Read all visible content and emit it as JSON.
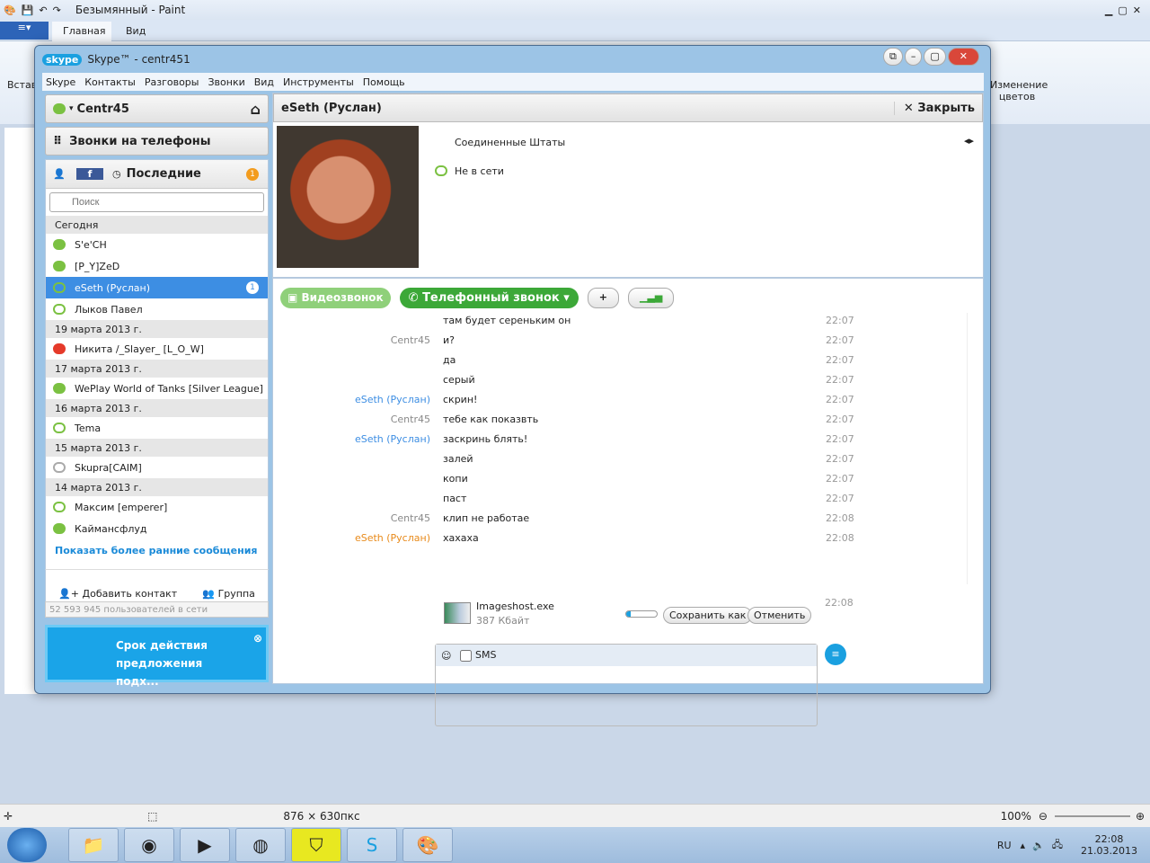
{
  "paint": {
    "title": "Безымянный - Paint",
    "tabs": [
      "Главная",
      "Вид"
    ],
    "paste": "Вставить",
    "colors": "Изменение цветов",
    "status_size": "876 × 630пкс",
    "zoom": "100%"
  },
  "skype": {
    "title": "Skype™ - centr451",
    "logo": "skype",
    "menu": [
      "Skype",
      "Контакты",
      "Разговоры",
      "Звонки",
      "Вид",
      "Инструменты",
      "Помощь"
    ],
    "user": "Centr45",
    "calls_phones": "Звонки на телефоны",
    "recent": "Последние",
    "recent_badge": "1",
    "search_placeholder": "Поиск",
    "contacts": [
      {
        "type": "date",
        "label": "Сегодня"
      },
      {
        "type": "c",
        "name": "S'e'CH",
        "status": "on"
      },
      {
        "type": "c",
        "name": "[P_Y]ZeD",
        "status": "on"
      },
      {
        "type": "c",
        "name": "eSeth (Руслан)",
        "status": "off",
        "selected": true,
        "badge": "1"
      },
      {
        "type": "c",
        "name": "Лыков Павел",
        "status": "off"
      },
      {
        "type": "date",
        "label": "19 марта 2013 г."
      },
      {
        "type": "c",
        "name": "Никита /_Slayer_ [L_O_W]",
        "status": "red"
      },
      {
        "type": "date",
        "label": "17 марта 2013 г."
      },
      {
        "type": "c",
        "name": "WePlay World of Tanks [Silver League]",
        "status": "on"
      },
      {
        "type": "date",
        "label": "16 марта 2013 г."
      },
      {
        "type": "c",
        "name": "Tema",
        "status": "off"
      },
      {
        "type": "date",
        "label": "15 марта 2013 г."
      },
      {
        "type": "c",
        "name": "Skupra[CAIM]",
        "status": "q"
      },
      {
        "type": "date",
        "label": "14 марта 2013 г."
      },
      {
        "type": "c",
        "name": "Максим [emperer]",
        "status": "off"
      },
      {
        "type": "c",
        "name": "Каймансфлуд",
        "status": "on"
      }
    ],
    "show_earlier": "Показать более ранние сообщения",
    "add_contact": "Добавить контакт",
    "group": "Группа",
    "online": "52 593 945 пользователей в сети",
    "promo": "Срок действия предложения подх...",
    "chat": {
      "name": "eSeth (Руслан)",
      "close": "Закрыть",
      "country": "Соединенные Штаты",
      "status": "Не в сети",
      "video": "Видеозвонок",
      "phone": "Телефонный звонок",
      "messages": [
        {
          "s": "",
          "t": "там будет сереньким он",
          "tm": "22:07"
        },
        {
          "s": "Centr45",
          "t": "и?",
          "tm": "22:07"
        },
        {
          "s": "",
          "t": "да",
          "tm": "22:07"
        },
        {
          "s": "",
          "t": "серый",
          "tm": "22:07"
        },
        {
          "s": "eSeth (Руслан)",
          "t": "скрин!",
          "tm": "22:07",
          "c": "#3d8ee3"
        },
        {
          "s": "Centr45",
          "t": "тебе как показвть",
          "tm": "22:07"
        },
        {
          "s": "eSeth (Руслан)",
          "t": "заскринь блять!",
          "tm": "22:07",
          "c": "#3d8ee3"
        },
        {
          "s": "",
          "t": "залей",
          "tm": "22:07"
        },
        {
          "s": "",
          "t": "копи",
          "tm": "22:07"
        },
        {
          "s": "",
          "t": "паст",
          "tm": "22:07"
        },
        {
          "s": "Centr45",
          "t": "клип не работае",
          "tm": "22:08"
        },
        {
          "s": "eSeth (Руслан)",
          "t": "хахаха",
          "tm": "22:08",
          "c": "#e88a1a"
        }
      ],
      "file": {
        "name": "Imageshost.exe",
        "size": "387 Кбайт",
        "time": "22:08",
        "save": "Сохранить как",
        "cancel": "Отменить",
        "progress": 0.15
      },
      "sms": "SMS"
    }
  },
  "taskbar": {
    "lang": "RU",
    "time": "22:08",
    "date": "21.03.2013"
  }
}
